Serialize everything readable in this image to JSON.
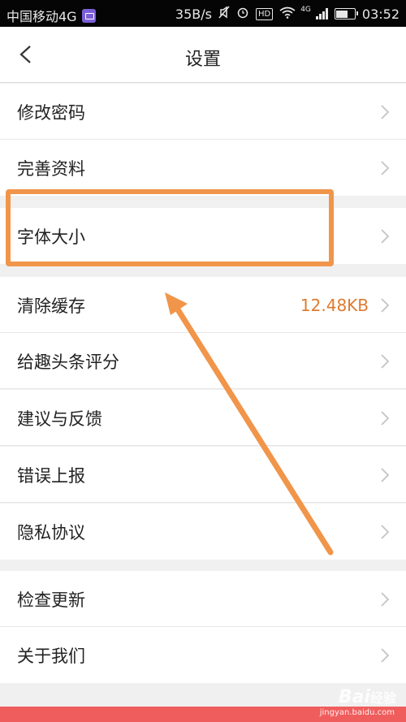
{
  "status_bar": {
    "carrier": "中国移动4G",
    "speed": "35B/s",
    "hd": "HD",
    "network": "4G",
    "time": "03:52"
  },
  "nav": {
    "title": "设置"
  },
  "settings": {
    "change_password": "修改密码",
    "complete_profile": "完善资料",
    "font_size": "字体大小",
    "clear_cache": "清除缓存",
    "cache_size": "12.48KB",
    "rate_app": "给趣头条评分",
    "feedback": "建议与反馈",
    "report_error": "错误上报",
    "privacy": "隐私协议",
    "check_update": "检查更新",
    "about_us": "关于我们"
  },
  "colors": {
    "accent": "#e07a30",
    "annotation": "#f0954a",
    "bottom_bar": "#f05d5d"
  },
  "watermark": {
    "logo": "Bai",
    "logo_suffix": "经验",
    "url": "jingyan.baidu.com"
  }
}
